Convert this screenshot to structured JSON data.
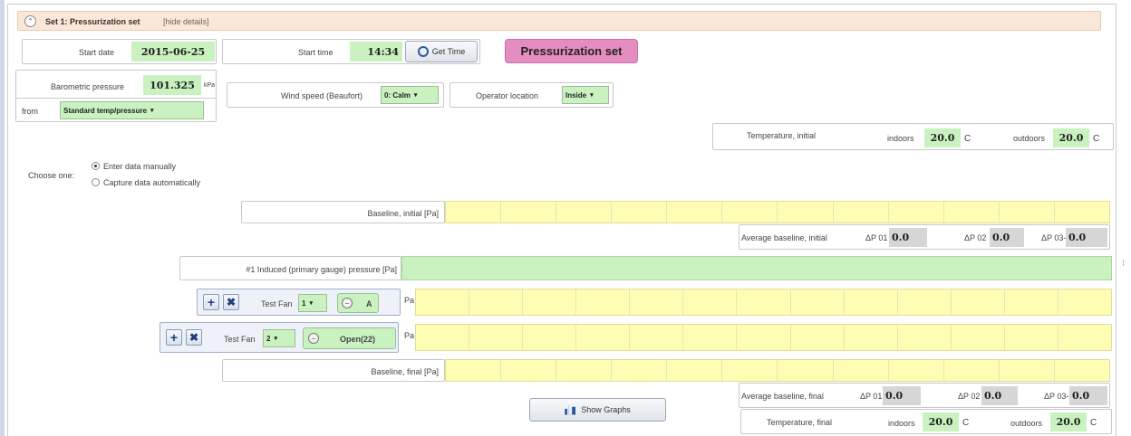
{
  "header": {
    "title": "Set 1: Pressurization set",
    "hide_link": "[hide details]"
  },
  "start_date": {
    "label": "Start date",
    "value": "2015-06-25"
  },
  "start_time": {
    "label": "Start time",
    "value": "14:34",
    "get_time_label": "Get Time"
  },
  "set_badge": "Pressurization set",
  "barometric": {
    "label": "Barometric pressure",
    "value": "101.325",
    "unit": "kPa",
    "from_label": "from",
    "from_value": "Standard temp/pressure"
  },
  "wind": {
    "label": "Wind speed (Beaufort)",
    "value": "0: Calm"
  },
  "operator": {
    "label": "Operator location",
    "value": "Inside"
  },
  "temp_initial": {
    "label": "Temperature, initial",
    "indoors_label": "indoors",
    "indoors_value": "20.0",
    "outdoors_label": "outdoors",
    "outdoors_value": "20.0",
    "unit": "C"
  },
  "choose": {
    "label": "Choose one:",
    "option1": "Enter data manually",
    "option2": "Capture data automatically"
  },
  "baseline_initial": {
    "label": "Baseline, initial [Pa]"
  },
  "avg_initial": {
    "label": "Average baseline, initial",
    "dp1_label": "ΔP 01",
    "dp1": "0.0",
    "dp2_label": "ΔP 02",
    "dp2": "0.0",
    "dp3_label": "ΔP 03-",
    "dp3": "0.0"
  },
  "induced": {
    "label": "#1 Induced (primary gauge) pressure [Pa]"
  },
  "fan1": {
    "label": "Test Fan",
    "num": "1",
    "ring": "A",
    "unit": "Pa"
  },
  "fan2": {
    "label": "Test Fan",
    "num": "2",
    "ring": "Open(22)",
    "unit": "Pa"
  },
  "baseline_final": {
    "label": "Baseline, final [Pa]"
  },
  "avg_final": {
    "label": "Average baseline, final",
    "dp1_label": "ΔP 01",
    "dp1": "0.0",
    "dp2_label": "ΔP 02",
    "dp2": "0.0",
    "dp3_label": "ΔP 03-",
    "dp3": "0.0"
  },
  "show_graphs": "Show Graphs",
  "temp_final": {
    "label": "Temperature, final",
    "indoors_label": "indoors",
    "indoors_value": "20.0",
    "outdoors_label": "outdoors",
    "outdoors_value": "20.0",
    "unit": "C"
  },
  "colors": {
    "header_bg": "#fbe7d8",
    "green": "#c9f2c0",
    "yellow": "#fdfdb4",
    "badge": "#e58cc0"
  }
}
